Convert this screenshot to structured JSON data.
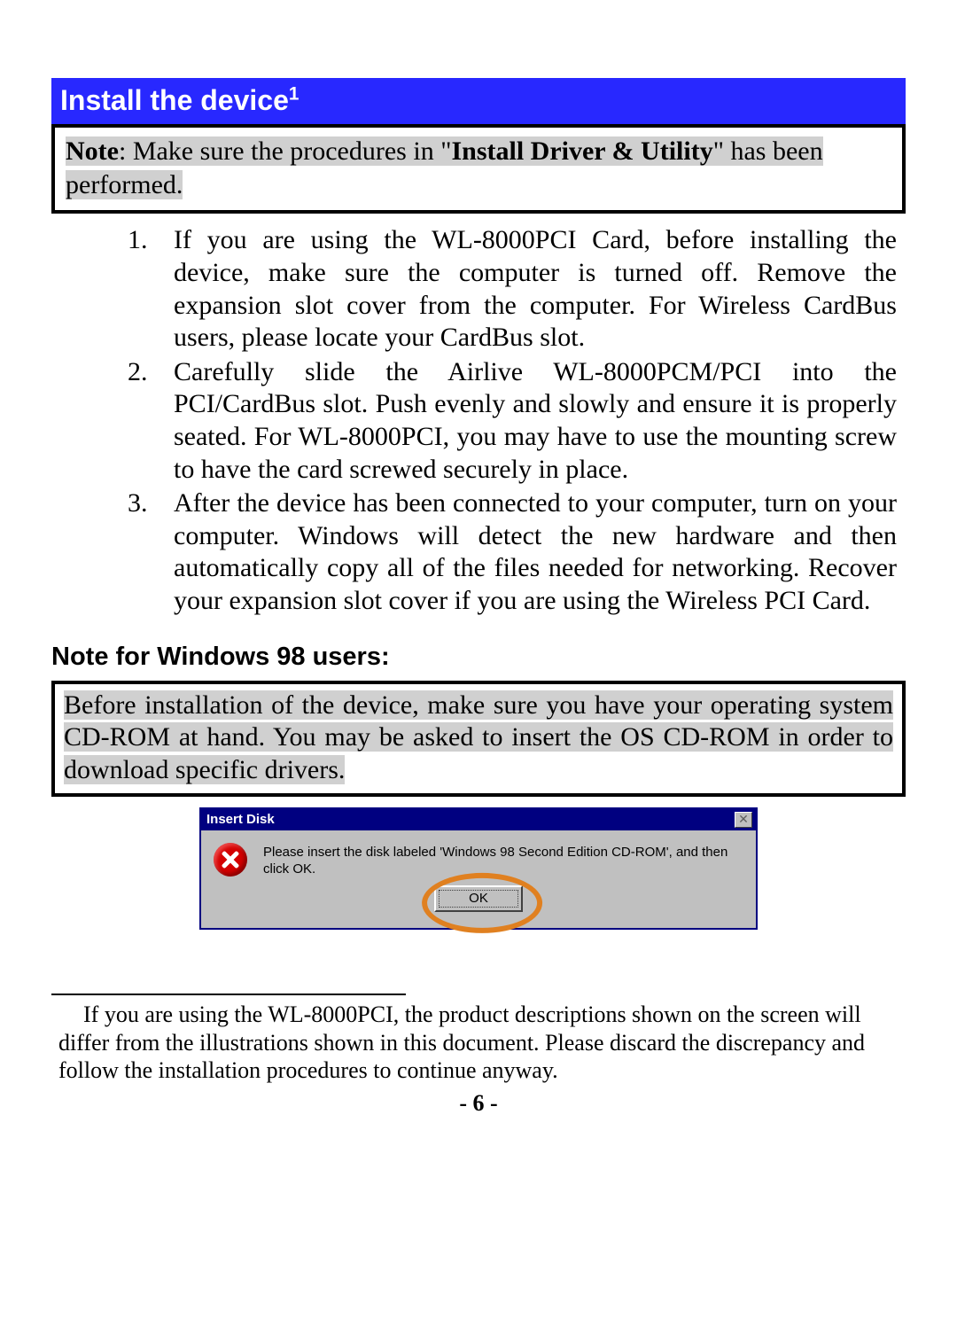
{
  "header": {
    "title": "Install the device",
    "sup": "1"
  },
  "note_box": {
    "prefix_bold": "Note",
    "text1": ": Make sure the procedures in \"",
    "bold_hl": "Install Driver & Utility",
    "text2": "\" has been ",
    "line2": "performed."
  },
  "steps": [
    "If you are using the WL-8000PCI Card, before installing the device, make sure the computer is turned off. Remove the expansion slot cover from the computer. For Wireless CardBus users, please locate your CardBus slot.",
    "Carefully slide the Airlive WL-8000PCM/PCI into the PCI/CardBus slot. Push evenly and slowly and ensure it is properly seated. For WL-8000PCI, you may have to use the mounting screw to have the card screwed securely in place.",
    "After the device has been connected to your computer, turn on your computer. Windows will detect the new hardware and then automatically copy all of the files needed for networking. Recover your expansion slot cover if you are using the Wireless PCI Card."
  ],
  "subheading": "Note for Windows 98 users:",
  "note_box2": "Before installation of the device, make sure you have your operating system CD-ROM at hand. You may be asked to insert the OS CD-ROM in order to download specific drivers.",
  "dialog": {
    "title": "Insert Disk",
    "close_glyph": "✕",
    "message": "Please insert the disk labeled 'Windows 98 Second Edition CD-ROM', and then click OK.",
    "ok_label": "OK"
  },
  "footnote": "If you are using the WL-8000PCI, the product descriptions shown on the screen will differ from the illustrations shown in this document. Please discard the discrepancy and follow the installation procedures to continue anyway.",
  "page_number": "- 6 -"
}
